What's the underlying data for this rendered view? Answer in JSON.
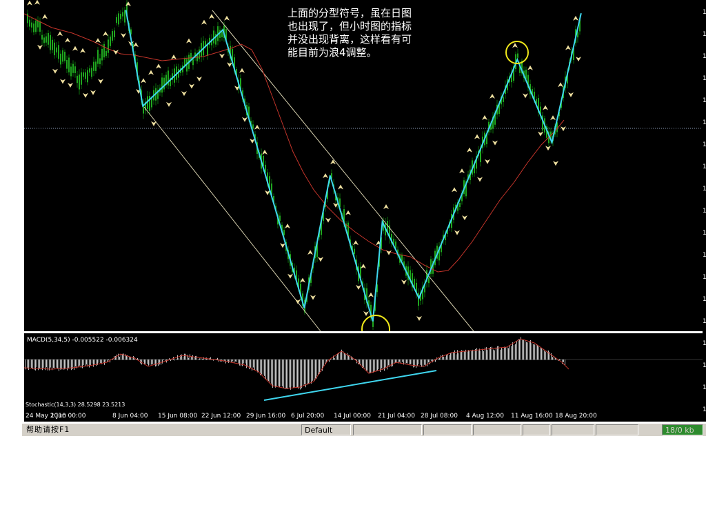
{
  "annotation": {
    "lines": [
      "上面的分型符号，虽在日图",
      "也出现了，但小时图的指标",
      "并没出现背离，这样看有可",
      "能目前为浪4调整。"
    ]
  },
  "indicators": {
    "macd_label": "MACD(5,34,5)  -0.005522  -0.006324",
    "stochastic_label": "Stochastic(14,3,3)  28.5298  23.5213"
  },
  "status_bar": {
    "help_text": "帮助请按F1",
    "profile": "Default",
    "connection": "18/0 kb"
  },
  "colors": {
    "candles": "#1fa81f",
    "candles_dark": "#0b6b0b",
    "zigzag": "#3fd6ef",
    "moving_average": "#c4342a",
    "channel": "#d8d2b0",
    "fractal": "#efe0a0",
    "highlight_circle": "#f0e81a",
    "macd_histogram": "#c8c8c8",
    "macd_signal": "#c4342a",
    "divergence_line": "#3fd6ef",
    "horizontal_level": "#8c9bb8"
  },
  "chart_data": [
    {
      "type": "candlestick-overlay",
      "timeframe": "hourly",
      "x_tick_labels": [
        "24 May 2010",
        "1 Jun 00:00",
        "8 Jun 04:00",
        "15 Jun 08:00",
        "22 Jun 12:00",
        "29 Jun 16:00",
        "6 Jul 20:00",
        "14 Jul 00:00",
        "21 Jul 04:00",
        "28 Jul 08:00",
        "4 Aug 12:00",
        "11 Aug 16:00",
        "18 Aug 20:00"
      ],
      "y_tick_labels": [
        "1",
        "1",
        "1",
        "1",
        "1",
        "1",
        "1",
        "1",
        "1",
        "1",
        "1",
        "1",
        "1",
        "1",
        "1",
        "1",
        "1",
        "1",
        "1"
      ],
      "zigzag_points": [
        {
          "x": 0.15,
          "y": 0.97
        },
        {
          "x": 0.175,
          "y": 0.68
        },
        {
          "x": 0.293,
          "y": 0.91
        },
        {
          "x": 0.413,
          "y": 0.07
        },
        {
          "x": 0.451,
          "y": 0.47
        },
        {
          "x": 0.514,
          "y": 0.03
        },
        {
          "x": 0.528,
          "y": 0.33
        },
        {
          "x": 0.582,
          "y": 0.1
        },
        {
          "x": 0.727,
          "y": 0.82
        },
        {
          "x": 0.778,
          "y": 0.57
        },
        {
          "x": 0.821,
          "y": 0.96
        }
      ],
      "annotations": [
        "circled fractal low near 21 Jul",
        "circled fractal high near 11 Aug"
      ]
    },
    {
      "type": "bar",
      "name": "MACD(5,34,5)",
      "value": -0.005522,
      "signal": -0.006324,
      "note": "histogram with signal line; divergence line drawn under lows from 29 Jun to 28 Jul"
    }
  ]
}
